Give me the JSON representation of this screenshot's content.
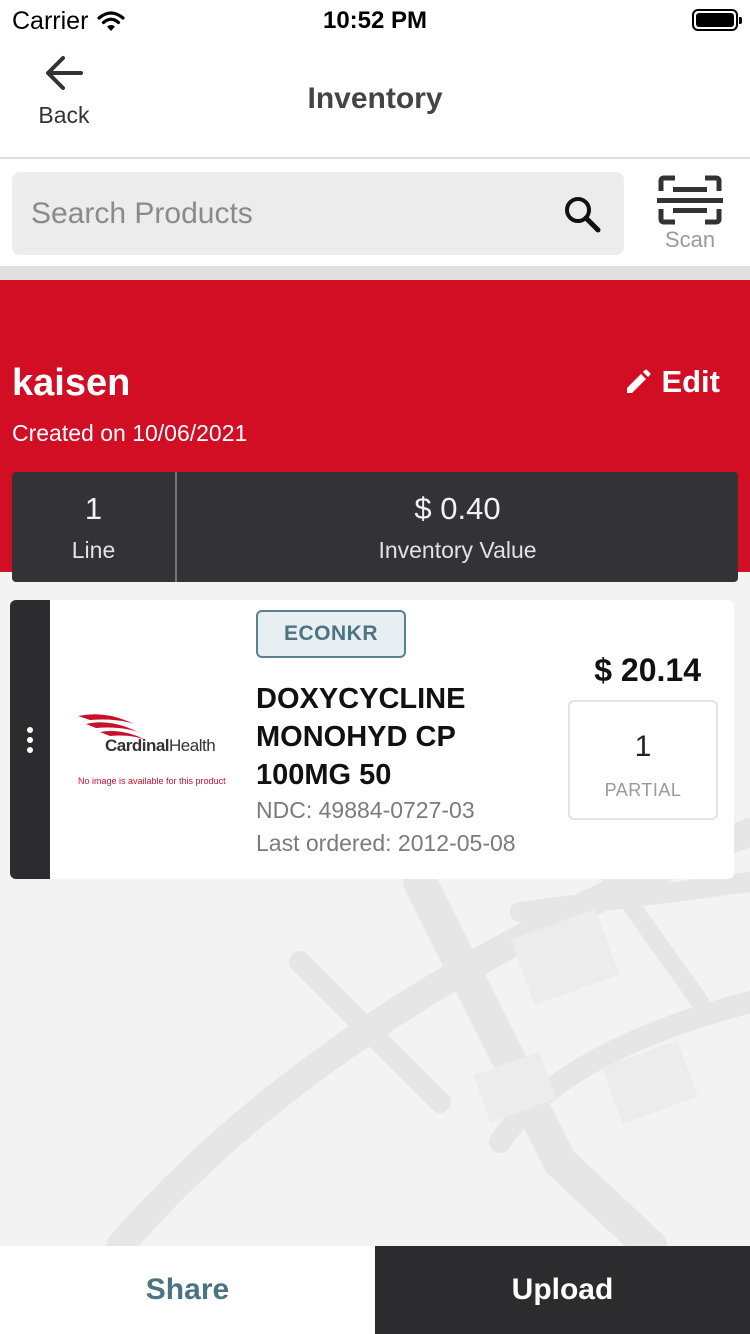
{
  "status_bar": {
    "carrier": "Carrier",
    "time": "10:52 PM"
  },
  "nav": {
    "back_label": "Back",
    "title": "Inventory"
  },
  "search": {
    "placeholder": "Search Products",
    "scan_label": "Scan"
  },
  "inventory": {
    "name": "kaisen",
    "created_on": "Created on 10/06/2021",
    "edit_label": "Edit",
    "stats": {
      "lines_value": "1",
      "lines_label": "Line",
      "value_amount": "$ 0.40",
      "value_label": "Inventory Value"
    }
  },
  "product": {
    "vendor_badge": "ECONKR",
    "name": "DOXYCYCLINE MONOHYD CP 100MG 50",
    "ndc": "NDC: 49884-0727-03",
    "last_ordered": "Last ordered: 2012-05-08",
    "price": "$ 20.14",
    "quantity": "1",
    "quantity_unit": "PARTIAL",
    "image": {
      "brand_text_bold": "Cardinal",
      "brand_text_rest": "Health",
      "no_image_text": "No image is available for this product"
    }
  },
  "footer": {
    "share_label": "Share",
    "upload_label": "Upload"
  },
  "colors": {
    "brand_red": "#d20e25",
    "dark": "#2c2c2e",
    "accent_teal": "#4b7381"
  }
}
